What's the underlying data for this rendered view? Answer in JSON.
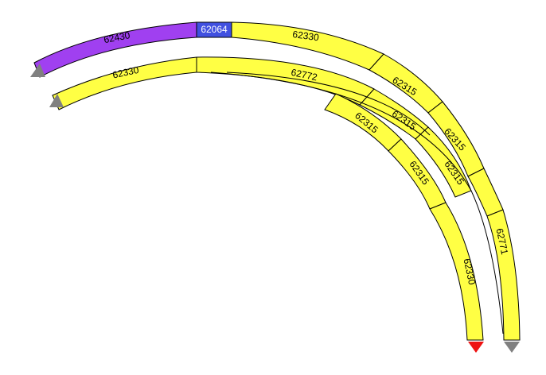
{
  "colors": {
    "track_yellow": "#ffff44",
    "track_purple": "#a040f0",
    "track_blue": "#4050e0",
    "connector_gray": "#808080",
    "connector_red": "#ee1111",
    "outline": "#000000"
  },
  "outer_track": {
    "pieces": [
      {
        "label": "62430",
        "color": "purple"
      },
      {
        "label": "62064",
        "color": "blue"
      },
      {
        "label": "62330",
        "color": "yellow"
      },
      {
        "label": "62315",
        "color": "yellow"
      },
      {
        "label": "62315",
        "color": "yellow"
      },
      {
        "label": "62315",
        "color": "yellow"
      },
      {
        "label": "62771",
        "color": "yellow"
      }
    ],
    "start_connector": "gray-triangle-icon",
    "end_connector": "gray-triangle-icon"
  },
  "inner_track": {
    "pieces": [
      {
        "label": "62330",
        "color": "yellow"
      },
      {
        "label": "62772",
        "color": "yellow"
      },
      {
        "label": "62315",
        "color": "yellow"
      },
      {
        "label": "62315",
        "color": "yellow"
      },
      {
        "label": "62315",
        "color": "yellow"
      },
      {
        "label": "62330",
        "color": "yellow"
      }
    ],
    "start_connector": "gray-triangle-icon",
    "end_connector": "red-triangle-icon"
  }
}
